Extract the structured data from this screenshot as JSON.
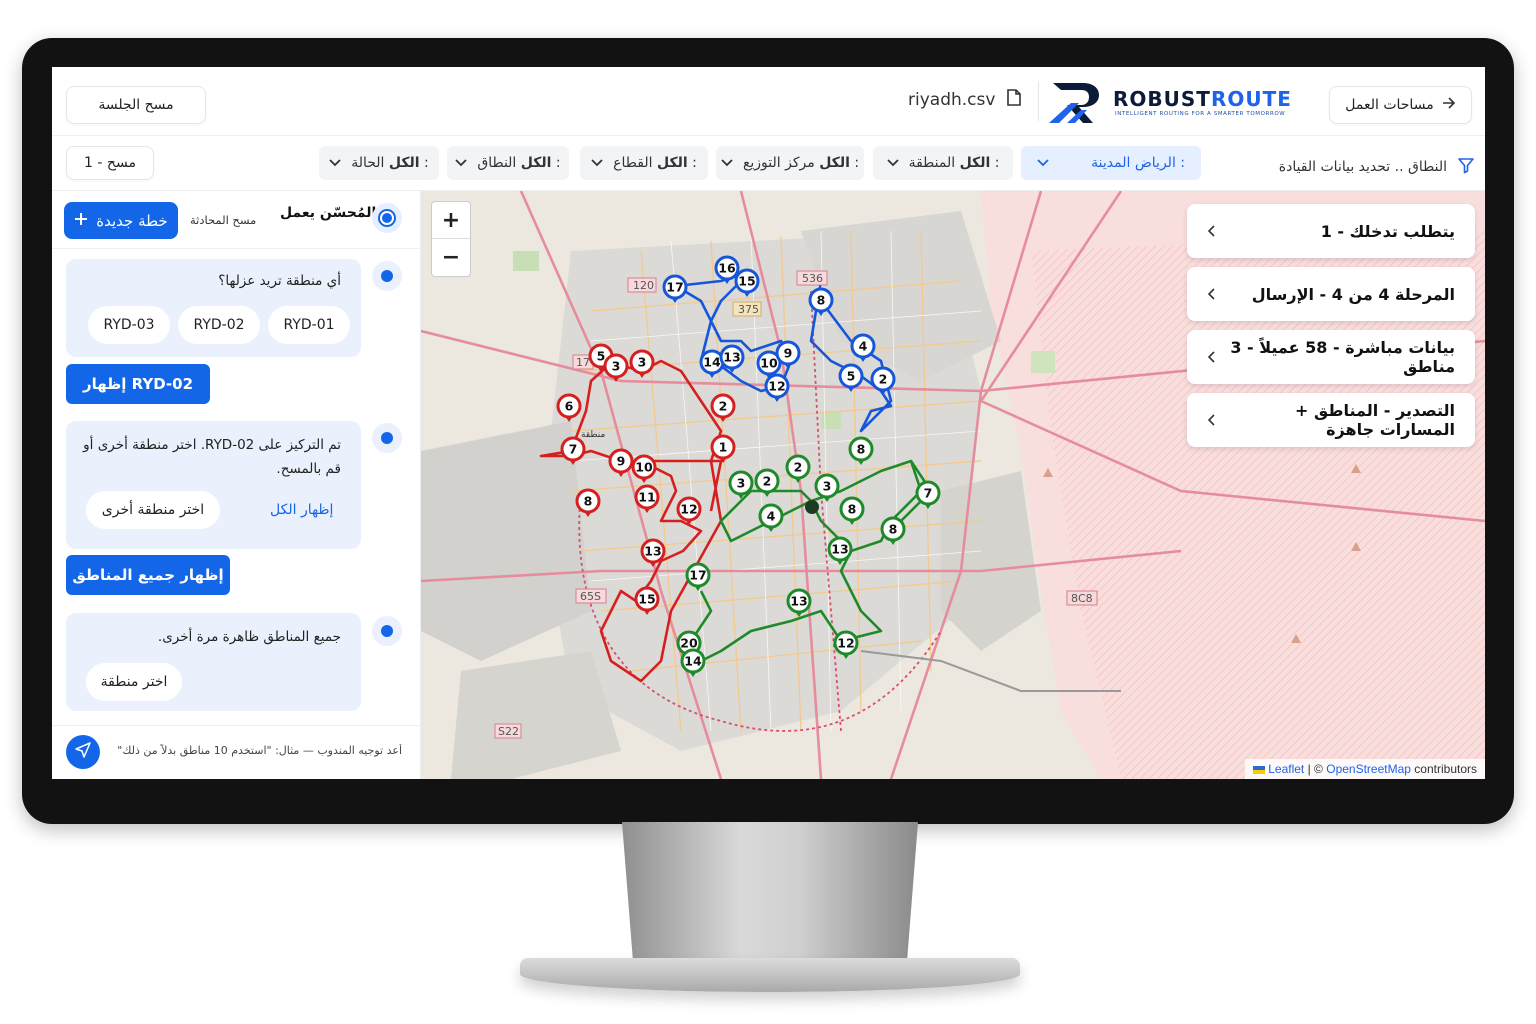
{
  "header": {
    "workspaces_label": "مساحات العمل",
    "file_name": "riyadh.csv",
    "clear_session_label": "مسح الجلسة",
    "logo": {
      "name_part1": "ROBUST",
      "name_part2": "ROUTE",
      "tagline": "INTELLIGENT ROUTING FOR A SMARTER TOMORROW"
    }
  },
  "filters": {
    "scope_label": "النطاق .. تحديد بيانات القيادة",
    "city": {
      "label": "المدينة :",
      "value": "الرياض"
    },
    "region": {
      "label": "المنطقة :",
      "value": "الكل"
    },
    "hub": {
      "label": "مركز التوزيع :",
      "value": "الكل"
    },
    "sector": {
      "label": "القطاع :",
      "value": "الكل"
    },
    "range": {
      "label": "النطاق :",
      "value": "الكل"
    },
    "status": {
      "label": "الحالة :",
      "value": "الكل"
    },
    "scan_label": "مسح - 1"
  },
  "chat": {
    "agent_status": "المُحسّن يعمل",
    "clear_chat_label": "مسح المحادثة",
    "new_plan_label": "خطة جديدة",
    "q1": "أي منطقة تريد عزلها؟",
    "zone_options": [
      "RYD-01",
      "RYD-02",
      "RYD-03"
    ],
    "show_zone_btn": "إظهار RYD-02",
    "msg2_line1": "تم التركيز على RYD-02. اختر منطقة أخرى أو",
    "msg2_line2": "قم بالمسح.",
    "show_all_link": "إظهار الكل",
    "pick_other_pill": "اختر منطقة أخرى",
    "show_all_zones_btn": "إظهار جميع المناطق",
    "msg3": "جميع المناطق ظاهرة مرة أخرى.",
    "pick_zone_pill": "اختر منطقة",
    "composer_placeholder": "أعد توجيه المندوب — مثال: \"استخدم 10 مناطق بدلاً من ذلك\""
  },
  "map": {
    "zoom_in": "+",
    "zoom_out": "−",
    "road_labels": [
      "120",
      "536",
      "375",
      "17",
      "65S",
      "S22",
      "8C8"
    ],
    "district_label": "منطقة",
    "cards": [
      "يتطلب تدخلك - 1",
      "المرحلة 4 من 4 - الإرسال",
      "بيانات مباشرة - 58 عميلاً - 3 مناطق",
      "التصدير - المناطق + المسارات جاهزة"
    ],
    "attribution": {
      "leaflet": "Leaflet",
      "sep": "| ©",
      "osm": "OpenStreetMap",
      "suffix": "contributors"
    },
    "route_colors": {
      "red": "#d42020",
      "blue": "#1656d8",
      "green": "#1f8a2a"
    }
  }
}
